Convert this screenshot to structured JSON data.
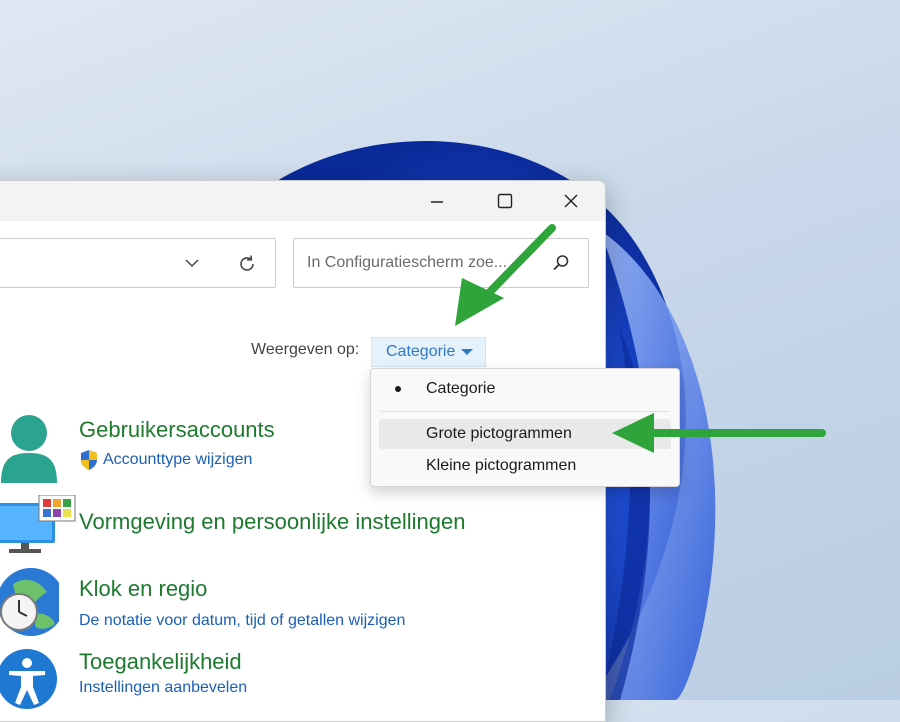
{
  "window": {
    "controls": {
      "minimize_icon": "minimize-icon",
      "maximize_icon": "maximize-icon",
      "close_icon": "close-icon"
    }
  },
  "address_bar": {
    "value": ""
  },
  "search": {
    "placeholder": "In Configuratiescherm zoe..."
  },
  "view": {
    "label": "Weergeven op:",
    "selected": "Categorie",
    "menu": [
      {
        "label": "Categorie",
        "selected": true
      },
      {
        "label": "Grote pictogrammen",
        "hovered": true
      },
      {
        "label": "Kleine pictogrammen"
      }
    ]
  },
  "categories": [
    {
      "title": "Gebruikersaccounts",
      "links": [
        "Accounttype wijzigen"
      ],
      "icon": "user-accounts-icon"
    },
    {
      "title": "Vormgeving en persoonlijke instellingen",
      "links": [],
      "icon": "appearance-icon"
    },
    {
      "title": "Klok en regio",
      "links": [
        "De notatie voor datum, tijd of getallen wijzigen"
      ],
      "icon": "clock-region-icon"
    },
    {
      "title": "Toegankelijkheid",
      "links": [
        "Instellingen aanbevelen"
      ],
      "icon": "accessibility-icon"
    }
  ],
  "colors": {
    "category_title": "#1d7a2f",
    "link": "#1c5fb8",
    "dropdown_text": "#2e78c6",
    "annotation_arrow": "#2ea43a"
  }
}
